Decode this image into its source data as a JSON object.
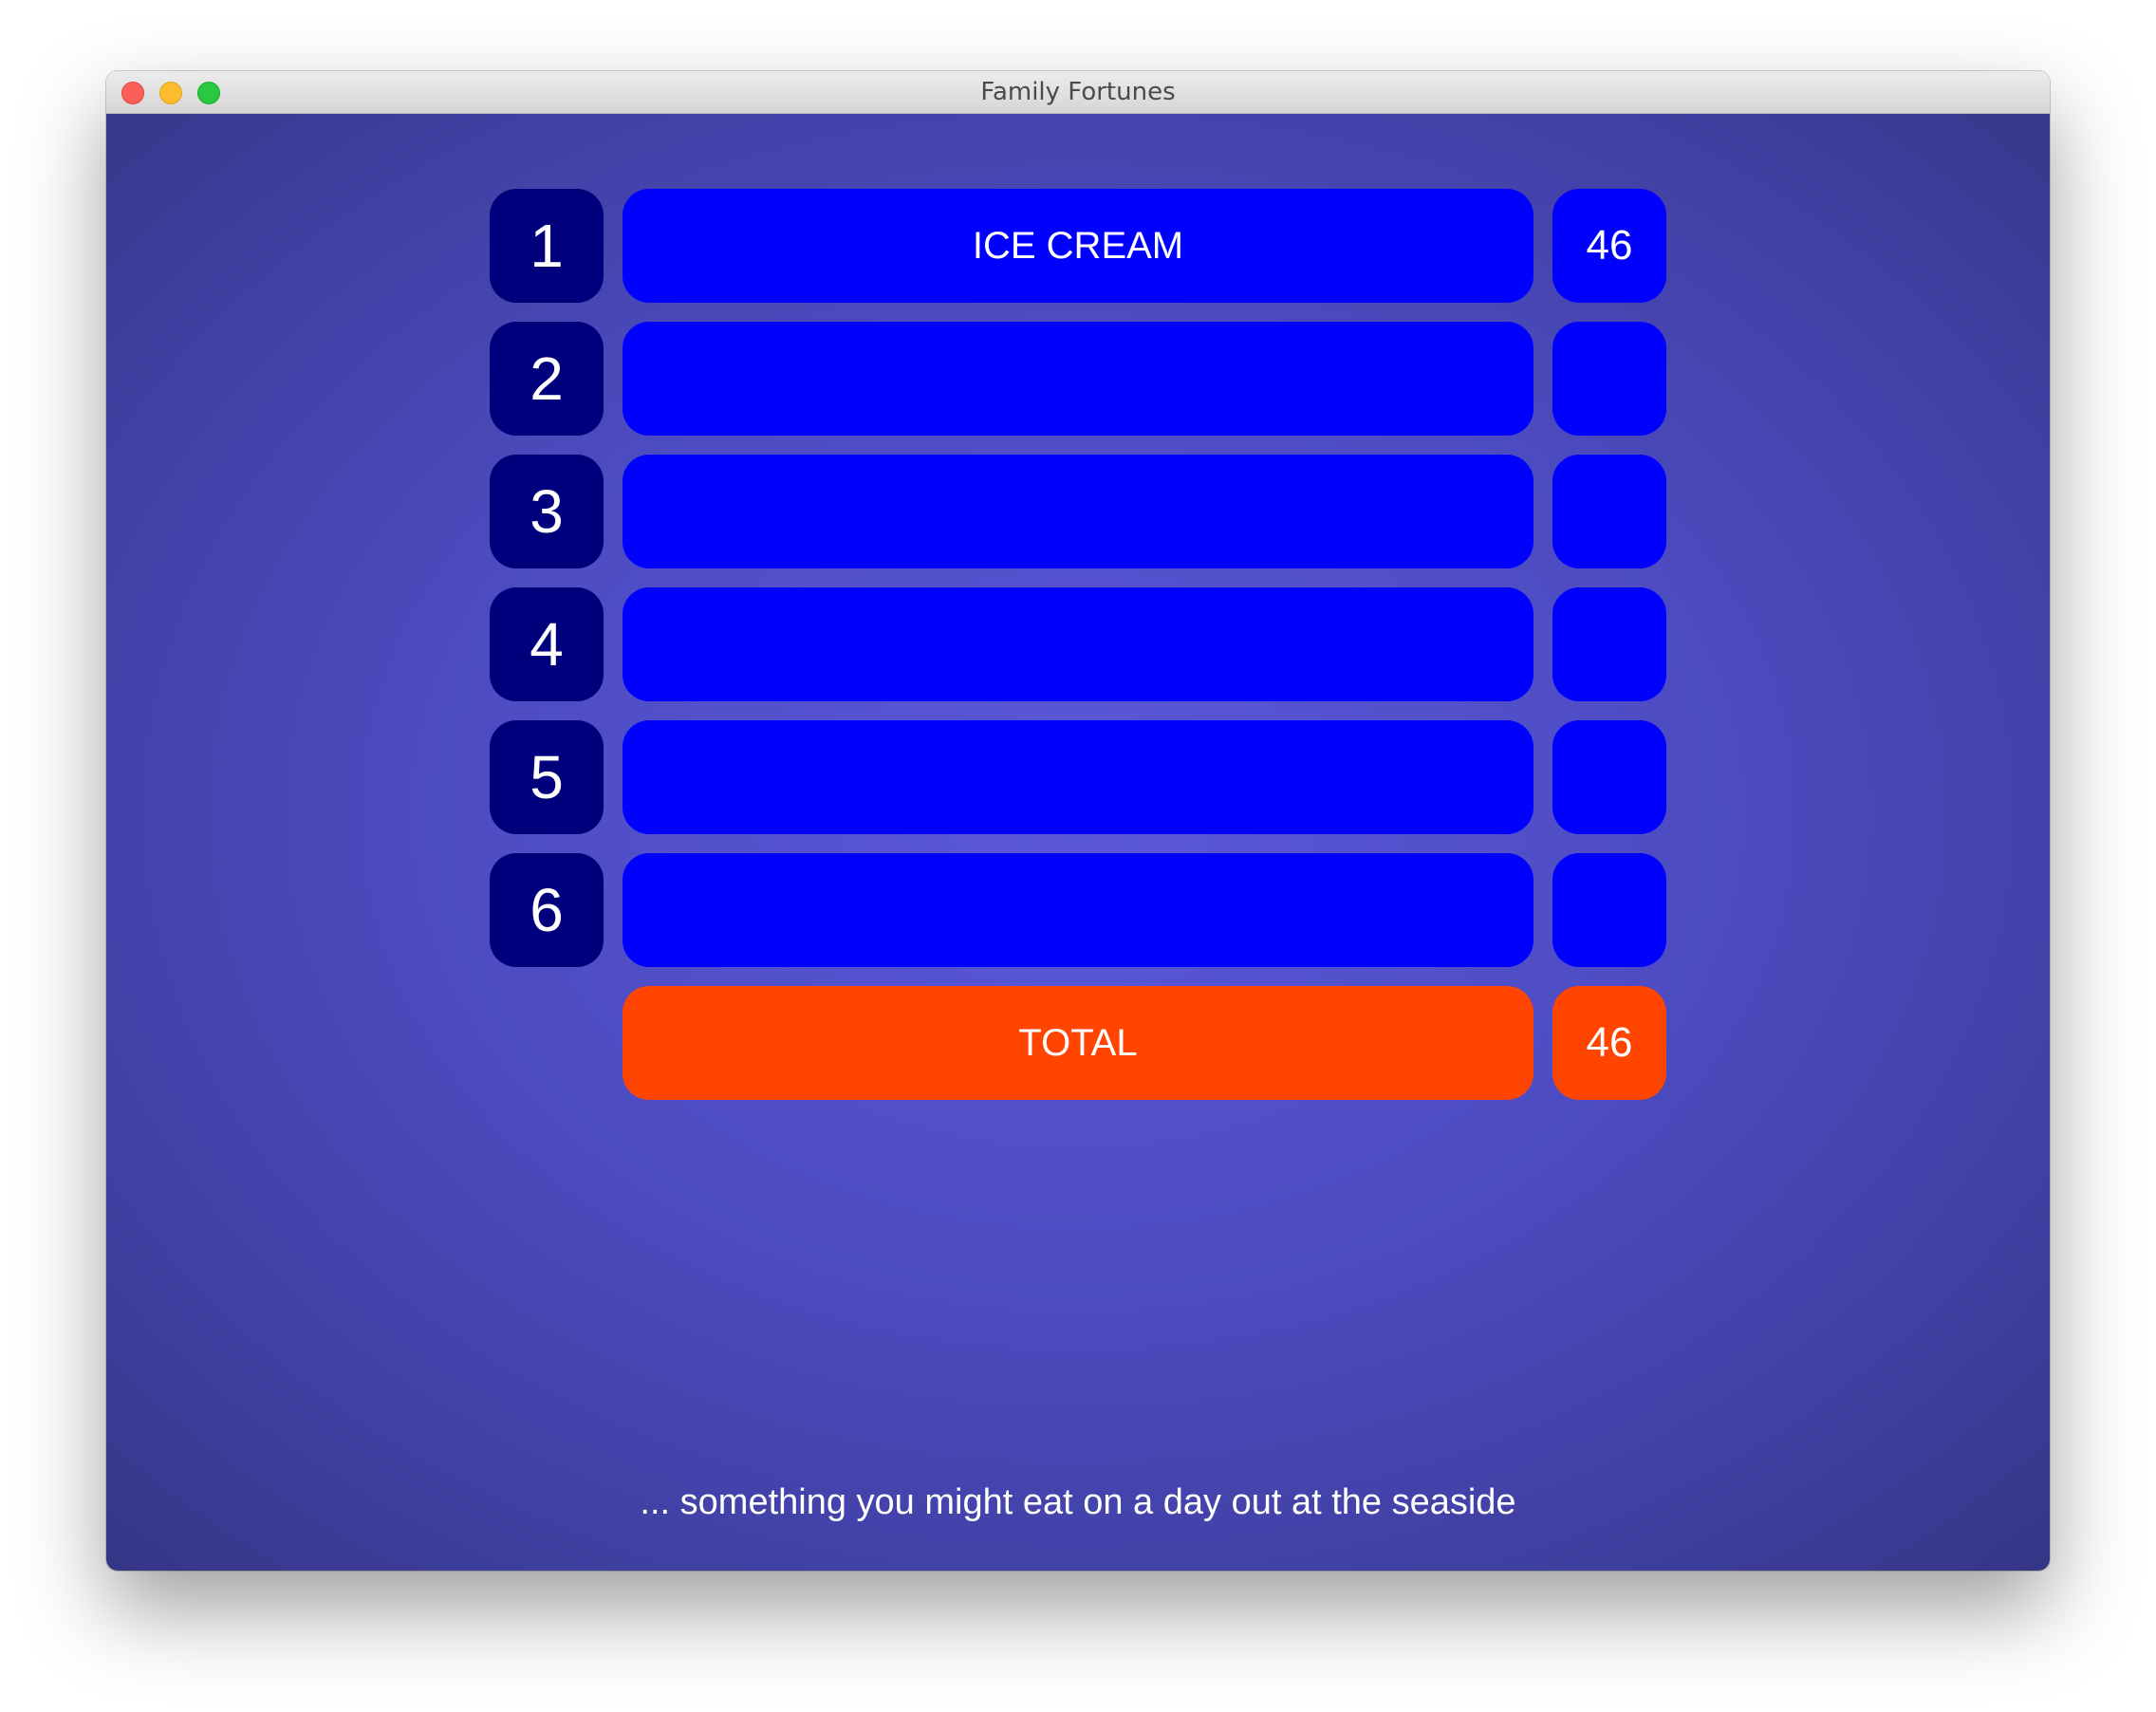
{
  "window": {
    "title": "Family Fortunes"
  },
  "board": {
    "rows": [
      {
        "number": "1",
        "answer": "ICE CREAM",
        "score": "46"
      },
      {
        "number": "2",
        "answer": "",
        "score": ""
      },
      {
        "number": "3",
        "answer": "",
        "score": ""
      },
      {
        "number": "4",
        "answer": "",
        "score": ""
      },
      {
        "number": "5",
        "answer": "",
        "score": ""
      },
      {
        "number": "6",
        "answer": "",
        "score": ""
      }
    ],
    "total": {
      "label": "TOTAL",
      "score": "46"
    }
  },
  "clue": "... something you might eat on a day out at the seaside",
  "colors": {
    "number_box": "#00007d",
    "answer_box": "#0000fd",
    "total_box": "#ff4500",
    "background_center": "#5a58da",
    "background_edge": "#313177"
  }
}
